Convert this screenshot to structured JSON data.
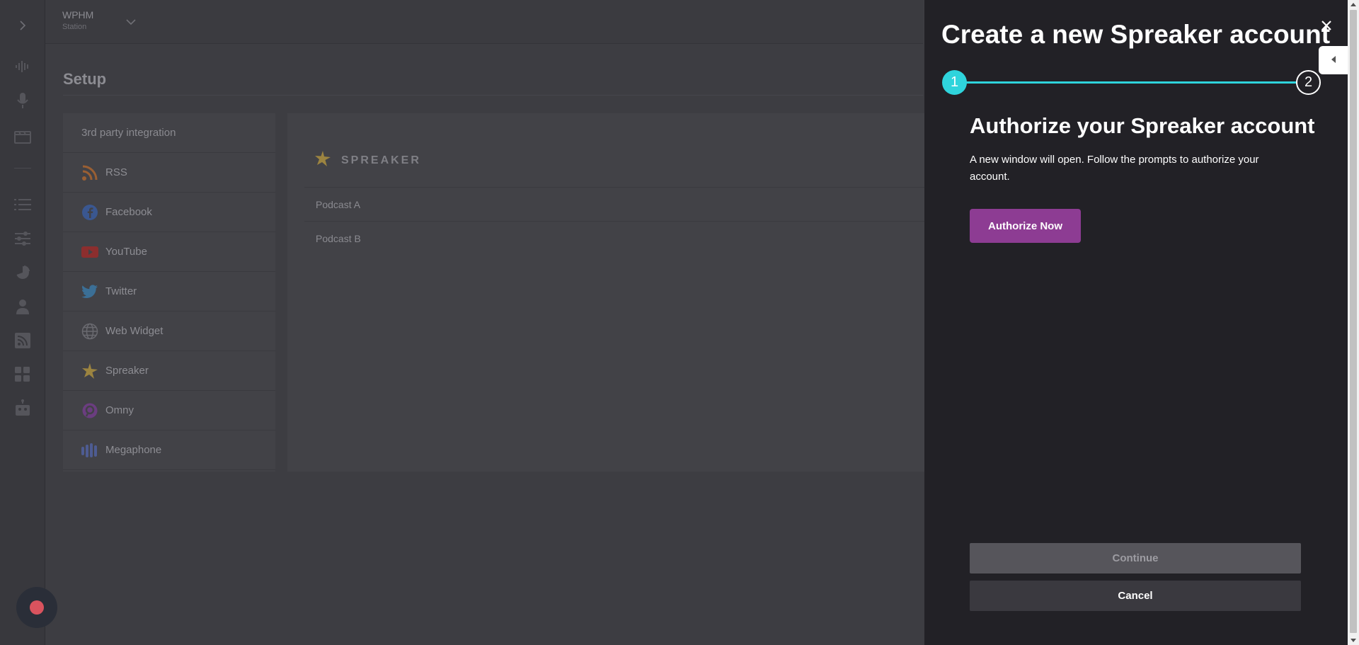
{
  "topbar": {
    "station_name": "WPHM",
    "station_role": "Station"
  },
  "page": {
    "title": "Setup"
  },
  "integrations": {
    "header": "3rd party integration",
    "items": [
      {
        "label": "RSS",
        "icon": "rss-icon"
      },
      {
        "label": "Facebook",
        "icon": "facebook-icon"
      },
      {
        "label": "YouTube",
        "icon": "youtube-icon"
      },
      {
        "label": "Twitter",
        "icon": "twitter-icon"
      },
      {
        "label": "Web Widget",
        "icon": "globe-icon"
      },
      {
        "label": "Spreaker",
        "icon": "spreaker-icon"
      },
      {
        "label": "Omny",
        "icon": "omny-icon"
      },
      {
        "label": "Megaphone",
        "icon": "megaphone-icon"
      }
    ]
  },
  "detail": {
    "brand": "SPREAKER",
    "podcasts": [
      "Podcast A",
      "Podcast B"
    ]
  },
  "drawer": {
    "title": "Create a new Spreaker account",
    "steps": [
      "1",
      "2"
    ],
    "heading": "Authorize your Spreaker account",
    "description": "A new window will open. Follow the prompts to authorize your account.",
    "authorize_label": "Authorize Now",
    "continue_label": "Continue",
    "cancel_label": "Cancel"
  },
  "colors": {
    "accent_teal": "#2fd4dc",
    "brand_purple": "#8d3c93",
    "record_red": "#d9535e"
  }
}
